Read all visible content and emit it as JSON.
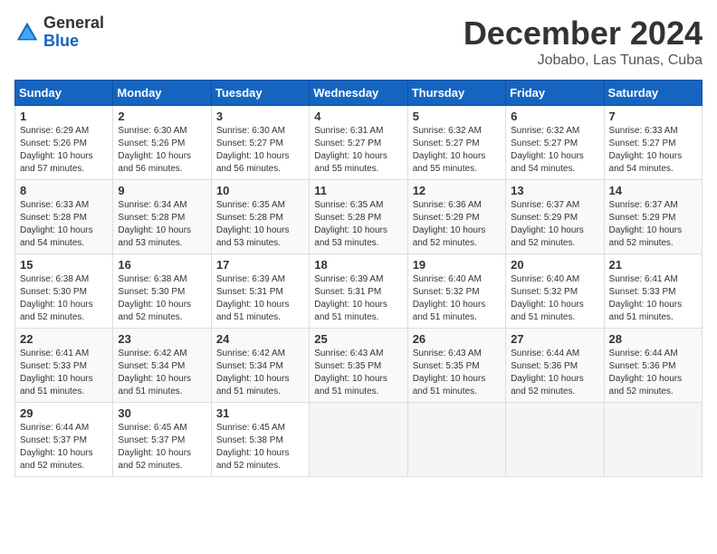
{
  "header": {
    "logo_general": "General",
    "logo_blue": "Blue",
    "month_title": "December 2024",
    "location": "Jobabo, Las Tunas, Cuba"
  },
  "calendar": {
    "days_of_week": [
      "Sunday",
      "Monday",
      "Tuesday",
      "Wednesday",
      "Thursday",
      "Friday",
      "Saturday"
    ],
    "weeks": [
      [
        null,
        {
          "day": "2",
          "sunrise": "6:30 AM",
          "sunset": "5:26 PM",
          "daylight": "10 hours and 56 minutes."
        },
        {
          "day": "3",
          "sunrise": "6:30 AM",
          "sunset": "5:27 PM",
          "daylight": "10 hours and 56 minutes."
        },
        {
          "day": "4",
          "sunrise": "6:31 AM",
          "sunset": "5:27 PM",
          "daylight": "10 hours and 55 minutes."
        },
        {
          "day": "5",
          "sunrise": "6:32 AM",
          "sunset": "5:27 PM",
          "daylight": "10 hours and 55 minutes."
        },
        {
          "day": "6",
          "sunrise": "6:32 AM",
          "sunset": "5:27 PM",
          "daylight": "10 hours and 54 minutes."
        },
        {
          "day": "7",
          "sunrise": "6:33 AM",
          "sunset": "5:27 PM",
          "daylight": "10 hours and 54 minutes."
        }
      ],
      [
        {
          "day": "1",
          "sunrise": "6:29 AM",
          "sunset": "5:26 PM",
          "daylight": "10 hours and 57 minutes."
        },
        {
          "day": "9",
          "sunrise": "6:34 AM",
          "sunset": "5:28 PM",
          "daylight": "10 hours and 53 minutes."
        },
        {
          "day": "10",
          "sunrise": "6:35 AM",
          "sunset": "5:28 PM",
          "daylight": "10 hours and 53 minutes."
        },
        {
          "day": "11",
          "sunrise": "6:35 AM",
          "sunset": "5:28 PM",
          "daylight": "10 hours and 53 minutes."
        },
        {
          "day": "12",
          "sunrise": "6:36 AM",
          "sunset": "5:29 PM",
          "daylight": "10 hours and 52 minutes."
        },
        {
          "day": "13",
          "sunrise": "6:37 AM",
          "sunset": "5:29 PM",
          "daylight": "10 hours and 52 minutes."
        },
        {
          "day": "14",
          "sunrise": "6:37 AM",
          "sunset": "5:29 PM",
          "daylight": "10 hours and 52 minutes."
        }
      ],
      [
        {
          "day": "8",
          "sunrise": "6:33 AM",
          "sunset": "5:28 PM",
          "daylight": "10 hours and 54 minutes."
        },
        {
          "day": "16",
          "sunrise": "6:38 AM",
          "sunset": "5:30 PM",
          "daylight": "10 hours and 52 minutes."
        },
        {
          "day": "17",
          "sunrise": "6:39 AM",
          "sunset": "5:31 PM",
          "daylight": "10 hours and 51 minutes."
        },
        {
          "day": "18",
          "sunrise": "6:39 AM",
          "sunset": "5:31 PM",
          "daylight": "10 hours and 51 minutes."
        },
        {
          "day": "19",
          "sunrise": "6:40 AM",
          "sunset": "5:32 PM",
          "daylight": "10 hours and 51 minutes."
        },
        {
          "day": "20",
          "sunrise": "6:40 AM",
          "sunset": "5:32 PM",
          "daylight": "10 hours and 51 minutes."
        },
        {
          "day": "21",
          "sunrise": "6:41 AM",
          "sunset": "5:33 PM",
          "daylight": "10 hours and 51 minutes."
        }
      ],
      [
        {
          "day": "15",
          "sunrise": "6:38 AM",
          "sunset": "5:30 PM",
          "daylight": "10 hours and 52 minutes."
        },
        {
          "day": "23",
          "sunrise": "6:42 AM",
          "sunset": "5:34 PM",
          "daylight": "10 hours and 51 minutes."
        },
        {
          "day": "24",
          "sunrise": "6:42 AM",
          "sunset": "5:34 PM",
          "daylight": "10 hours and 51 minutes."
        },
        {
          "day": "25",
          "sunrise": "6:43 AM",
          "sunset": "5:35 PM",
          "daylight": "10 hours and 51 minutes."
        },
        {
          "day": "26",
          "sunrise": "6:43 AM",
          "sunset": "5:35 PM",
          "daylight": "10 hours and 51 minutes."
        },
        {
          "day": "27",
          "sunrise": "6:44 AM",
          "sunset": "5:36 PM",
          "daylight": "10 hours and 52 minutes."
        },
        {
          "day": "28",
          "sunrise": "6:44 AM",
          "sunset": "5:36 PM",
          "daylight": "10 hours and 52 minutes."
        }
      ],
      [
        {
          "day": "22",
          "sunrise": "6:41 AM",
          "sunset": "5:33 PM",
          "daylight": "10 hours and 51 minutes."
        },
        {
          "day": "30",
          "sunrise": "6:45 AM",
          "sunset": "5:37 PM",
          "daylight": "10 hours and 52 minutes."
        },
        {
          "day": "31",
          "sunrise": "6:45 AM",
          "sunset": "5:38 PM",
          "daylight": "10 hours and 52 minutes."
        },
        null,
        null,
        null,
        null
      ],
      [
        {
          "day": "29",
          "sunrise": "6:44 AM",
          "sunset": "5:37 PM",
          "daylight": "10 hours and 52 minutes."
        },
        null,
        null,
        null,
        null,
        null,
        null
      ]
    ]
  }
}
